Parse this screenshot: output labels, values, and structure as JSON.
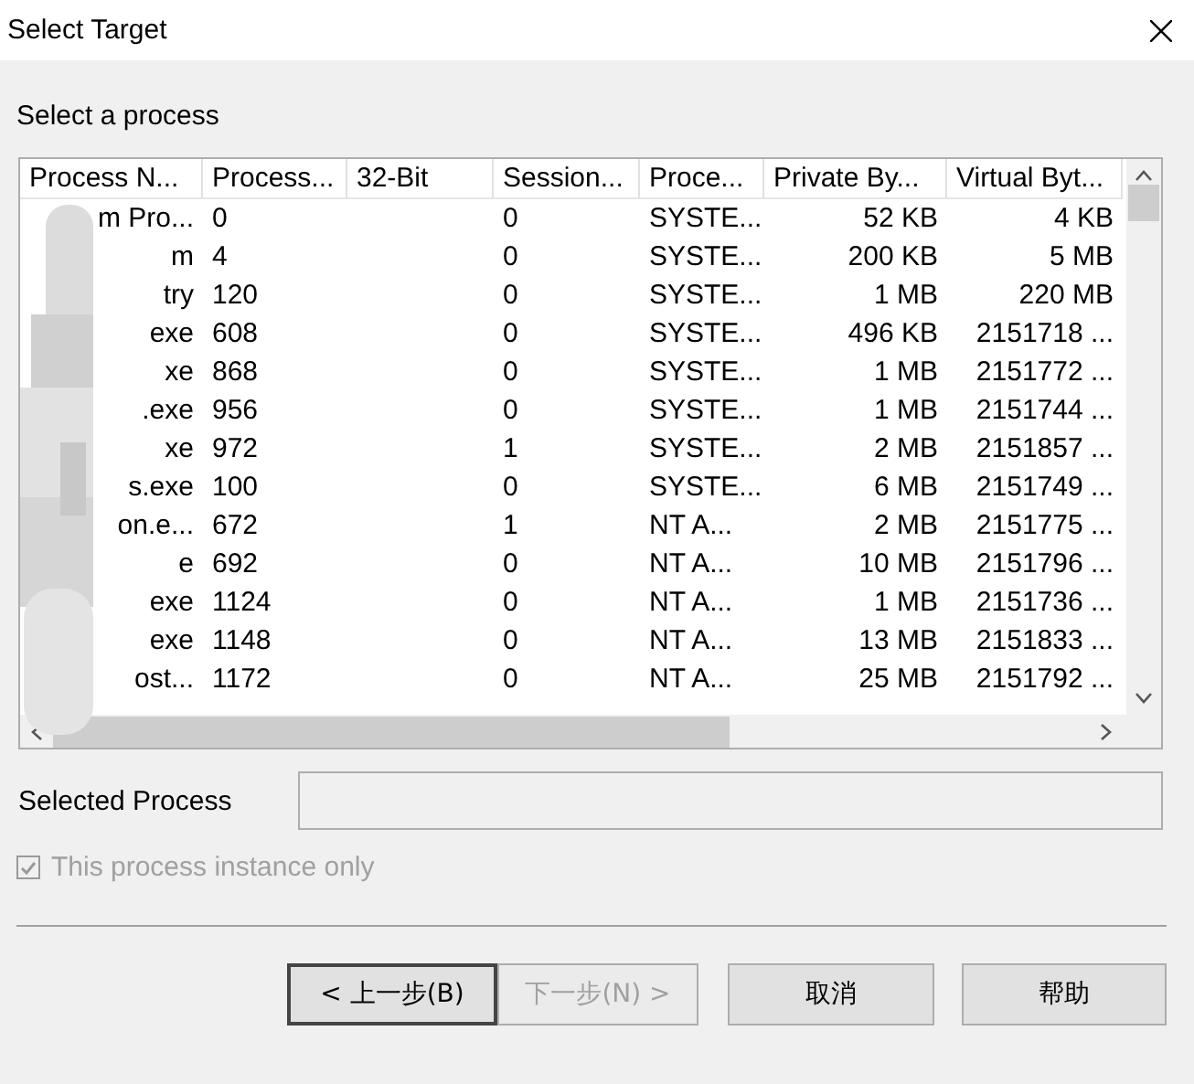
{
  "window": {
    "title": "Select Target"
  },
  "heading": "Select a process",
  "table": {
    "columns": [
      "Process N...",
      "Process...",
      "32-Bit",
      "Session...",
      "Proce...",
      "Private By...",
      "Virtual Byt..."
    ],
    "rows": [
      [
        "m Pro...",
        "0",
        "",
        "0",
        "SYSTE...",
        "52 KB",
        "4 KB"
      ],
      [
        "m",
        "4",
        "",
        "0",
        "SYSTE...",
        "200 KB",
        "5 MB"
      ],
      [
        "try",
        "120",
        "",
        "0",
        "SYSTE...",
        "1 MB",
        "220 MB"
      ],
      [
        "exe",
        "608",
        "",
        "0",
        "SYSTE...",
        "496 KB",
        "2151718 ..."
      ],
      [
        "xe",
        "868",
        "",
        "0",
        "SYSTE...",
        "1 MB",
        "2151772 ..."
      ],
      [
        ".exe",
        "956",
        "",
        "0",
        "SYSTE...",
        "1 MB",
        "2151744 ..."
      ],
      [
        "xe",
        "972",
        "",
        "1",
        "SYSTE...",
        "2 MB",
        "2151857 ..."
      ],
      [
        "s.exe",
        "100",
        "",
        "0",
        "SYSTE...",
        "6 MB",
        "2151749 ..."
      ],
      [
        "on.e...",
        "672",
        "",
        "1",
        "NT A...",
        "2 MB",
        "2151775 ..."
      ],
      [
        "e",
        "692",
        "",
        "0",
        "NT A...",
        "10 MB",
        "2151796 ..."
      ],
      [
        "exe",
        "1124",
        "",
        "0",
        "NT A...",
        "1 MB",
        "2151736 ..."
      ],
      [
        "exe",
        "1148",
        "",
        "0",
        "NT A...",
        "13 MB",
        "2151833 ..."
      ],
      [
        "ost...",
        "1172",
        "",
        "0",
        "NT A...",
        "25 MB",
        "2151792 ..."
      ]
    ]
  },
  "selected_process": {
    "label": "Selected Process"
  },
  "instance_only": {
    "label": "This process instance only",
    "checked": true,
    "disabled": true
  },
  "buttons": [
    {
      "label": "< 上一步(B)",
      "disabled": false,
      "kind": "default"
    },
    {
      "label": "下一步(N) >",
      "disabled": true,
      "kind": "normal"
    },
    {
      "label": "取消",
      "disabled": false,
      "kind": "normal"
    },
    {
      "label": "帮助",
      "disabled": false,
      "kind": "normal"
    }
  ]
}
